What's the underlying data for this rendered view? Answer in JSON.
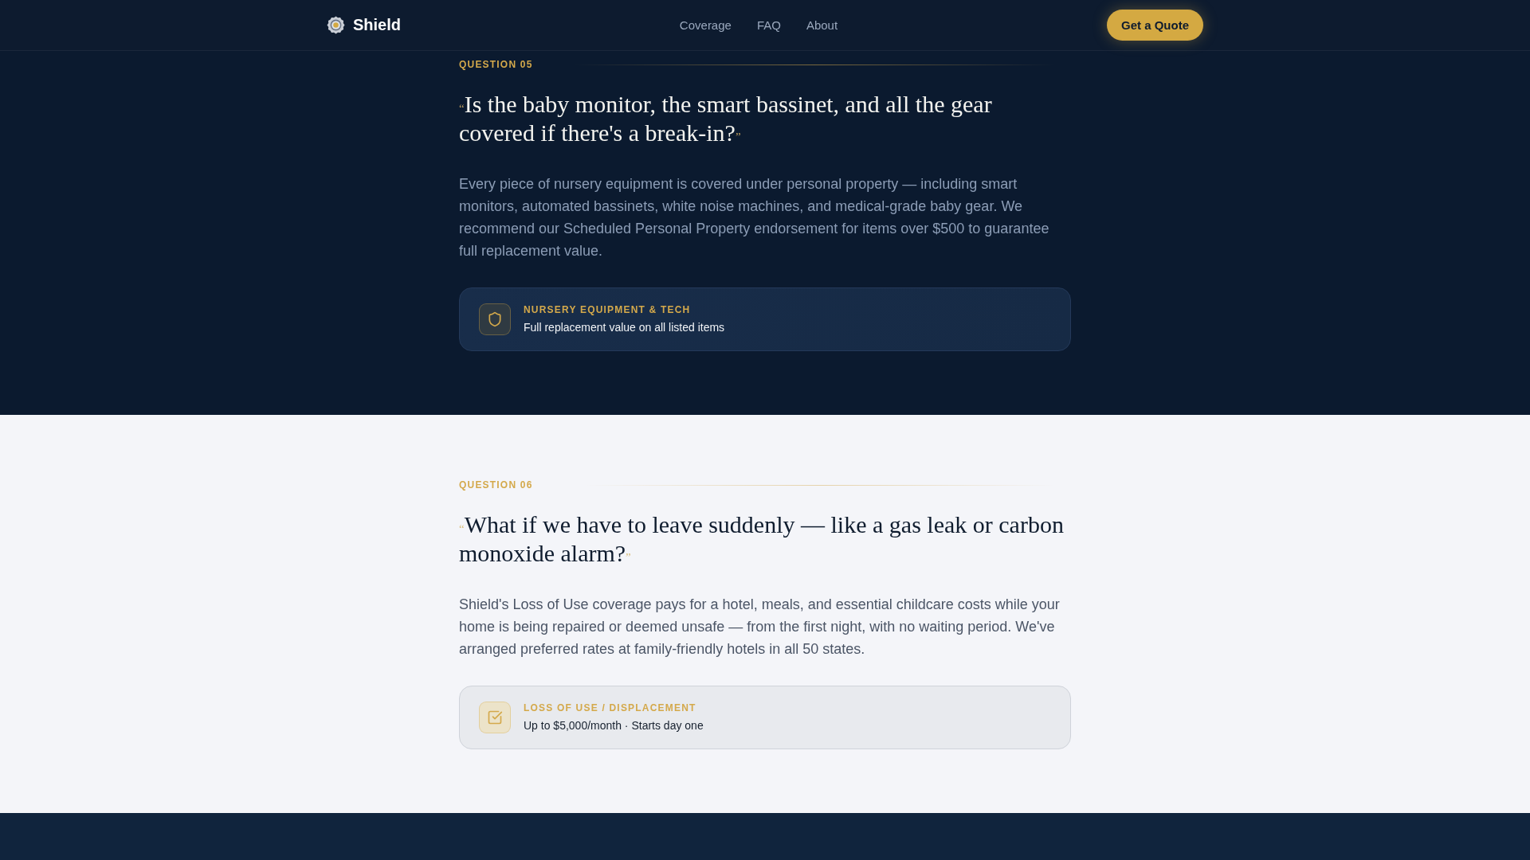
{
  "nav": {
    "brand": "Shield",
    "links": [
      "Coverage",
      "FAQ",
      "About"
    ],
    "cta": "Get a Quote"
  },
  "sections": [
    {
      "kind": "dark",
      "label": "QUESTION 05",
      "quote_open": "“",
      "question": "Is the baby monitor, the smart bassinet, and all the gear covered if there's a break-in?",
      "quote_close": "”",
      "answer": "Every piece of nursery equipment is covered under personal property — including smart monitors, automated bassinets, white noise machines, and medical-grade baby gear. We recommend our Scheduled Personal Property endorsement for items over $500 to guarantee full replacement value.",
      "highlight": {
        "title": "NURSERY EQUIPMENT & TECH",
        "detail": "Full replacement value on all listed items"
      }
    },
    {
      "kind": "light",
      "label": "QUESTION 06",
      "quote_open": "“",
      "question": "What if we have to leave suddenly — like a gas leak or carbon monoxide alarm?",
      "quote_close": "”",
      "answer": "Shield's Loss of Use coverage pays for a hotel, meals, and essential childcare costs while your home is being repaired or deemed unsafe — from the first night, with no waiting period. We've arranged preferred rates at family-friendly hotels in all 50 states.",
      "highlight": {
        "title": "LOSS OF USE / DISPLACEMENT",
        "detail": "Up to $5,000/month · Starts day one"
      }
    }
  ]
}
